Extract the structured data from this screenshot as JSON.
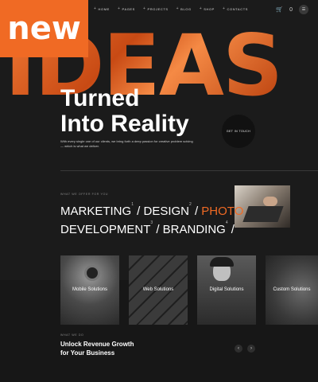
{
  "badge": "new",
  "nav": {
    "items": [
      "HOME",
      "PAGES",
      "PROJECTS",
      "BLOG",
      "SHOP",
      "CONTACTS"
    ]
  },
  "header_icons": {
    "cart": "cart-icon",
    "cart_count": "0",
    "menu": "menu-icon"
  },
  "hero": {
    "big_word": "IDEAS",
    "headline_line1": "Turned",
    "headline_line2": "Into Reality",
    "lead": "With every single one of our clients, we bring forth a deep passion for creative problem solving — which is what we deliver.",
    "cta": "GET IN TOUCH"
  },
  "offer": {
    "eyebrow": "WHAT WE OFFER FOR YOU",
    "services": [
      {
        "label": "MARKETING",
        "sup": "1"
      },
      {
        "label": "DESIGN",
        "sup": "2"
      },
      {
        "label": "PHOTO",
        "sup": ""
      },
      {
        "label": "DEVELOPMENT",
        "sup": "3"
      },
      {
        "label": "BRANDING",
        "sup": "4"
      }
    ]
  },
  "cards": [
    {
      "label": "Mobile Solutions"
    },
    {
      "label": "Web Solutions"
    },
    {
      "label": "Digital Solutions"
    },
    {
      "label": "Custom Solutions"
    }
  ],
  "growth": {
    "eyebrow": "WHAT WE DO",
    "title_line1": "Unlock Revenue Growth",
    "title_line2": "for Your Business"
  },
  "colors": {
    "accent": "#f06a24",
    "background": "#1b1b1b"
  }
}
